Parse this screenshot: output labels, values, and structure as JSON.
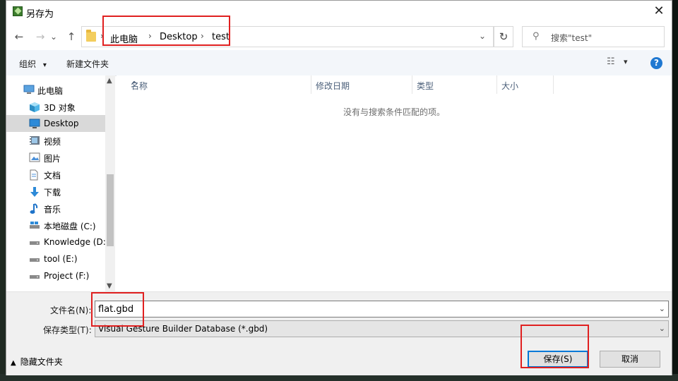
{
  "window": {
    "title": "另存为",
    "close_glyph": "✕",
    "icon": "app-icon"
  },
  "nav": {
    "back_glyph": "←",
    "forward_glyph": "→",
    "dropdown_glyph": "⌄",
    "up_glyph": "↑",
    "refresh_glyph": "↻",
    "separator": "›",
    "address_dropdown_glyph": "⌄",
    "breadcrumbs": [
      "此电脑",
      "Desktop",
      "test"
    ],
    "search_placeholder": "搜索\"test\"",
    "search_glyph": "⚲"
  },
  "toolbar": {
    "organize_label": "组织",
    "organize_caret": "▾",
    "new_folder_label": "新建文件夹",
    "view_glyph": "☷",
    "view_caret": "▾",
    "help_glyph": "?"
  },
  "sidebar": {
    "items": [
      {
        "label": "此电脑",
        "icon": "computer-icon",
        "selected": false
      },
      {
        "label": "3D 对象",
        "icon": "cube-3d-icon",
        "selected": false
      },
      {
        "label": "Desktop",
        "icon": "desktop-icon",
        "selected": true
      },
      {
        "label": "视频",
        "icon": "video-icon",
        "selected": false
      },
      {
        "label": "图片",
        "icon": "picture-icon",
        "selected": false
      },
      {
        "label": "文档",
        "icon": "document-icon",
        "selected": false
      },
      {
        "label": "下载",
        "icon": "download-arrow-icon",
        "selected": false
      },
      {
        "label": "音乐",
        "icon": "music-note-icon",
        "selected": false
      },
      {
        "label": "本地磁盘 (C:)",
        "icon": "drive-icon",
        "selected": false
      },
      {
        "label": "Knowledge (D:",
        "icon": "drive-icon",
        "selected": false
      },
      {
        "label": "tool (E:)",
        "icon": "drive-icon",
        "selected": false
      },
      {
        "label": "Project (F:)",
        "icon": "drive-icon",
        "selected": false
      }
    ],
    "scroll_up_glyph": "▲",
    "scroll_down_glyph": "▼"
  },
  "file_list": {
    "columns": [
      "名称",
      "修改日期",
      "类型",
      "大小"
    ],
    "sort_glyph": "^",
    "empty_message": "没有与搜索条件匹配的项。"
  },
  "form": {
    "filename_label": "文件名(N):",
    "filename_value": "flat.gbd",
    "filetype_label": "保存类型(T):",
    "filetype_value": "Visual Gesture Builder Database (*.gbd)",
    "dropdown_glyph": "⌄"
  },
  "footer": {
    "hide_folders_caret": "▲",
    "hide_folders_label": "隐藏文件夹",
    "save_label": "保存(S)",
    "cancel_label": "取消"
  },
  "colors": {
    "highlight": "#e02020",
    "accent": "#0078d7",
    "selection": "#d9d9d9"
  }
}
